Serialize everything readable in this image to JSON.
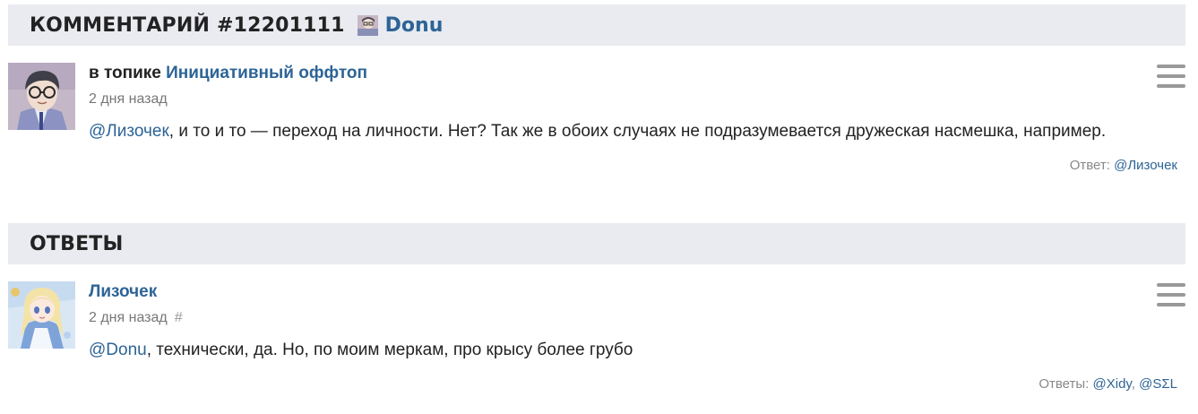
{
  "comment": {
    "header_title": "КОММЕНТАРИЙ #12201111",
    "header_user": "Donu",
    "in_topic_prefix": "в топике",
    "topic_name": "Инициативный оффтоп",
    "date": "2 дня назад",
    "mention": "@Лизочек",
    "text": ", и то и то — переход на личности. Нет? Так же в обоих случаях не подразумевается дружеская насмешка, например.",
    "replies_label": "Ответ:",
    "replies": [
      "@Лизочек"
    ],
    "avatar_icon": "user-avatar-anime-boy-glasses",
    "menu_icon": "hamburger-menu-icon"
  },
  "answers": {
    "header_title": "ОТВЕТЫ",
    "items": [
      {
        "author": "Лизочек",
        "date": "2 дня назад",
        "permalink": "#",
        "mention": "@Donu",
        "text": ", технически, да. Но, по моим меркам, про крысу более грубо",
        "replies_label": "Ответы:",
        "replies": [
          "@Xidy",
          "@SΣL"
        ],
        "avatar_icon": "user-avatar-anime-girl-blonde",
        "menu_icon": "hamburger-menu-icon"
      }
    ]
  },
  "colors": {
    "link": "#2d6496",
    "header_bg": "#e9ebf0",
    "muted": "#777777"
  }
}
